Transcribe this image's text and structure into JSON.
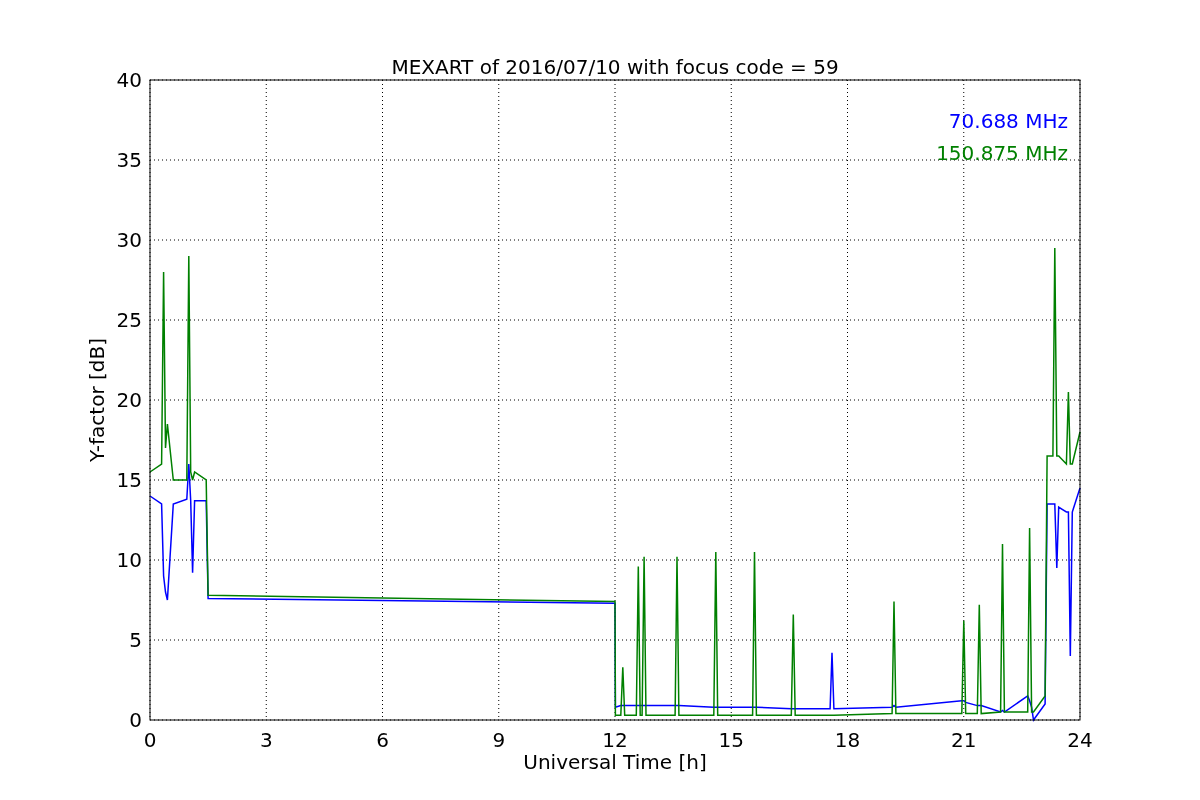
{
  "figure": {
    "chart_data": {
      "type": "line",
      "title": "MEXART of 2016/07/10 with focus code = 59",
      "xlabel": "Universal Time [h]",
      "ylabel": "Y-factor [dB]",
      "grid": true,
      "x": [
        0,
        0.3,
        0.35,
        0.4,
        0.45,
        0.6,
        0.95,
        1.0,
        1.05,
        1.1,
        1.15,
        1.45,
        1.5,
        12.0,
        12.01,
        12.15,
        12.2,
        12.25,
        12.55,
        12.6,
        12.65,
        12.7,
        12.75,
        12.8,
        13.55,
        13.6,
        13.65,
        14.55,
        14.6,
        14.65,
        15.55,
        15.6,
        15.65,
        16.55,
        16.6,
        16.65,
        17.55,
        17.6,
        17.65,
        19.15,
        19.2,
        19.25,
        20.95,
        21.0,
        21.05,
        21.35,
        21.4,
        21.45,
        21.95,
        22.0,
        22.05,
        22.65,
        22.7,
        22.75,
        22.8,
        23.1,
        23.15,
        23.3,
        23.35,
        23.4,
        23.45,
        23.65,
        23.7,
        23.75,
        23.8,
        24
      ],
      "series": [
        {
          "name": "70.688 MHz",
          "color": "#0000ff",
          "values": [
            14,
            13.5,
            9,
            8,
            7.5,
            13.5,
            13.8,
            16,
            13.7,
            9.2,
            13.7,
            13.7,
            7.6,
            7.3,
            0.8,
            0.9,
            0.9,
            0.9,
            0.9,
            0.9,
            0.9,
            0.9,
            0.9,
            0.9,
            0.9,
            0.9,
            0.9,
            0.8,
            0.8,
            0.8,
            0.8,
            0.8,
            0.8,
            0.7,
            0.7,
            0.7,
            0.7,
            4.2,
            0.7,
            0.8,
            0.9,
            0.8,
            1.2,
            1.2,
            1.1,
            0.9,
            0.9,
            0.9,
            0.5,
            0.6,
            0.5,
            1.5,
            1.2,
            0.8,
            0,
            1,
            13.5,
            13.5,
            13.5,
            9.5,
            13.3,
            13,
            13,
            4,
            13,
            14.5
          ]
        },
        {
          "name": "150.875 MHz",
          "color": "#008000",
          "values": [
            15.5,
            16,
            28,
            17,
            18.5,
            15,
            15,
            29,
            15.5,
            15,
            15.5,
            15,
            7.8,
            7.4,
            0.3,
            0.3,
            3.3,
            0.3,
            0.3,
            9.6,
            0.3,
            0.3,
            10.2,
            0.3,
            0.3,
            10.2,
            0.3,
            0.3,
            10.5,
            0.3,
            0.3,
            10.5,
            0.3,
            0.3,
            6.6,
            0.3,
            0.3,
            0.3,
            0.3,
            0.4,
            7.4,
            0.4,
            0.4,
            6.2,
            0.4,
            0.4,
            7.2,
            0.4,
            0.5,
            11,
            0.5,
            0.5,
            12,
            0.5,
            0.5,
            1.5,
            16.5,
            16.5,
            29.5,
            16.5,
            16.5,
            16,
            20.5,
            16,
            16,
            18
          ]
        }
      ],
      "xlim": [
        0,
        24
      ],
      "ylim": [
        0,
        40
      ],
      "xticks": [
        0,
        3,
        6,
        9,
        12,
        15,
        18,
        21,
        24
      ],
      "yticks": [
        0,
        5,
        10,
        15,
        20,
        25,
        30,
        35,
        40
      ]
    }
  }
}
